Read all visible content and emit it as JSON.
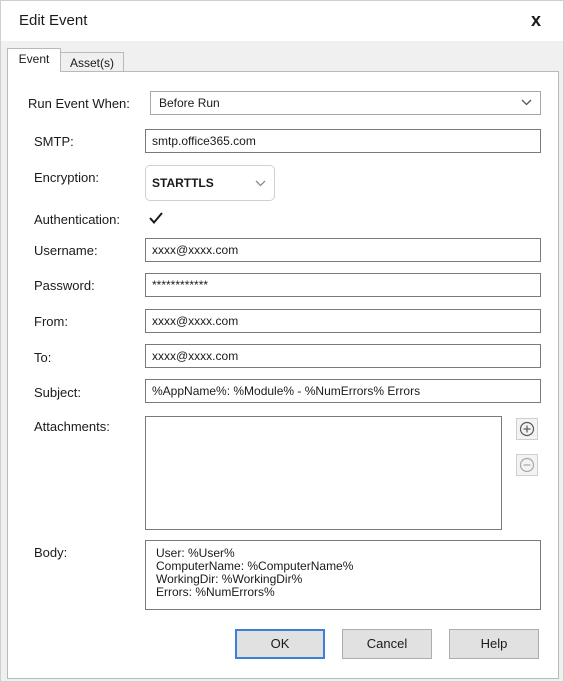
{
  "window": {
    "title": "Edit Event",
    "close_glyph": "x"
  },
  "tabs": [
    {
      "label": "Event",
      "active": true
    },
    {
      "label": "Asset(s)",
      "active": false
    }
  ],
  "form": {
    "run_event_when": {
      "label": "Run Event When:",
      "value": "Before Run"
    },
    "smtp": {
      "label": "SMTP:",
      "value": "smtp.office365.com"
    },
    "encryption": {
      "label": "Encryption:",
      "value": "STARTTLS"
    },
    "authentication": {
      "label": "Authentication:",
      "checked": true
    },
    "username": {
      "label": "Username:",
      "value": "xxxx@xxxx.com"
    },
    "password": {
      "label": "Password:",
      "value": "************"
    },
    "from": {
      "label": "From:",
      "value": "xxxx@xxxx.com"
    },
    "to": {
      "label": "To:",
      "value": "xxxx@xxxx.com"
    },
    "subject": {
      "label": "Subject:",
      "value": "%AppName%: %Module% - %NumErrors% Errors"
    },
    "attachments": {
      "label": "Attachments:"
    },
    "body": {
      "label": "Body:",
      "lines": [
        "User: %User%",
        "ComputerName: %ComputerName%",
        "WorkingDir: %WorkingDir%",
        "Errors: %NumErrors%"
      ]
    }
  },
  "buttons": {
    "ok": "OK",
    "cancel": "Cancel",
    "help": "Help"
  },
  "icons": {
    "add": "plus-circle-icon",
    "remove": "minus-circle-icon",
    "dropdown": "chevron-down-icon",
    "check": "checkmark-icon"
  },
  "colors": {
    "accent": "#3c7fd6",
    "panel": "#ffffff",
    "chrome": "#f0f0f0"
  }
}
